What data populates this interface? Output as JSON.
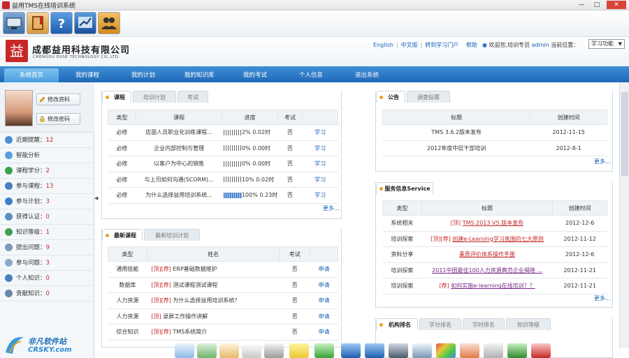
{
  "window": {
    "title": "益用TMS在线培训系统",
    "min": "—",
    "max": "□",
    "close": "✕"
  },
  "header": {
    "logo_char": "益",
    "company": "成都益用科技有限公司",
    "company_en": "CHENGDU EUSE TECHNOLOGY CO.,LTD.",
    "links": [
      "English",
      "中文版",
      "转到学习门户",
      "帮助"
    ],
    "welcome": "欢迎您,培训专员",
    "user": "admin",
    "position_label": "当前位置：",
    "func_select": "学习功能"
  },
  "nav": [
    "系统首页",
    "我的课程",
    "我的计划",
    "我的知识库",
    "我的考试",
    "个人信息",
    "退出系统"
  ],
  "sidebar": {
    "edit_profile": "修改资料",
    "edit_password": "修改密码",
    "items": [
      {
        "label": "近期提醒：",
        "count": "12",
        "color": "#4a8fd0"
      },
      {
        "label": "智能分析",
        "count": "",
        "color": "#5aa0e0"
      },
      {
        "label": "课程学分：",
        "count": "2",
        "color": "#3aa34a"
      },
      {
        "label": "参与课程：",
        "count": "13",
        "color": "#4a7fc0"
      },
      {
        "label": "参与计划：",
        "count": "3",
        "color": "#3a83c8"
      },
      {
        "label": "获得认证：",
        "count": "0",
        "color": "#5a90c0"
      },
      {
        "label": "知识等级：",
        "count": "1",
        "color": "#3aa34a"
      },
      {
        "label": "提出问题：",
        "count": "9",
        "color": "#7a9ab8"
      },
      {
        "label": "参与问题：",
        "count": "3",
        "color": "#8aa8c8"
      },
      {
        "label": "个人知识：",
        "count": "0",
        "color": "#4a7fc0"
      },
      {
        "label": "贡献知识：",
        "count": "0",
        "color": "#6a88a8"
      }
    ]
  },
  "course_panel": {
    "tabs": [
      "课程",
      "培训计划",
      "考试"
    ],
    "headers": [
      "类型",
      "课程",
      "进度",
      "考试",
      ""
    ],
    "rows": [
      {
        "type": "必修",
        "course": "店面人员职业化训练课程...",
        "progress": "2% 0.02时",
        "exam": "否",
        "action": "学习",
        "full": false
      },
      {
        "type": "必修",
        "course": "企业内部控制与管理",
        "progress": "0% 0.00时",
        "exam": "否",
        "action": "学习",
        "full": false
      },
      {
        "type": "必修",
        "course": "以客户为中心的销售",
        "progress": "0% 0.00时",
        "exam": "否",
        "action": "学习",
        "full": false
      },
      {
        "type": "必修",
        "course": "与上司如何沟通(SCORM)...",
        "progress": "10% 0.02时",
        "exam": "否",
        "action": "学习",
        "full": false
      },
      {
        "type": "必修",
        "course": "为什么选择益用培训系统...",
        "progress": "100% 0.23时",
        "exam": "否",
        "action": "学习",
        "full": true
      }
    ],
    "more": "更多..."
  },
  "newcourse_panel": {
    "tabs": [
      "最新课程",
      "最新培训计划"
    ],
    "headers": [
      "类型",
      "姓名",
      "考试",
      ""
    ],
    "rows": [
      {
        "type": "通用技能",
        "tag": "[顶][荐]",
        "name": "ERP基础数据维护",
        "exam": "否",
        "action": "申请"
      },
      {
        "type": "数据库",
        "tag": "[顶][荐]",
        "name": "测试课程测试课程",
        "exam": "否",
        "action": "申请"
      },
      {
        "type": "人力资源",
        "tag": "[顶][荐]",
        "name": "为什么选择益用培训系统？",
        "exam": "否",
        "action": "申请"
      },
      {
        "type": "人力资源",
        "tag": "[顶]",
        "name": "录屏工作操作讲解",
        "exam": "否",
        "action": "申请"
      },
      {
        "type": "综合知识",
        "tag": "[顶][荐]",
        "name": "TMS系统简介",
        "exam": "否",
        "action": "申请"
      }
    ]
  },
  "notice_panel": {
    "tabs": [
      "公告",
      "调查投票"
    ],
    "headers": [
      "标题",
      "创建时间"
    ],
    "rows": [
      {
        "title": "TMS 3.6.2版本发布",
        "date": "2012-11-15"
      },
      {
        "title": "2012年度中层干部培训",
        "date": "2012-8-1"
      }
    ],
    "more": "更多..."
  },
  "service_panel": {
    "tabs": [
      "服务信息Service"
    ],
    "headers": [
      "类型",
      "标题",
      "创建时间"
    ],
    "rows": [
      {
        "type": "系统相关",
        "tag": "[顶]",
        "title": "TMS 2013 V5 版本发布",
        "date": "2012-12-6"
      },
      {
        "type": "培训探索",
        "tag": "[顶][荐]",
        "title": "创建e-Learning学习氛围的七大原则",
        "date": "2012-11-12"
      },
      {
        "type": "资料分享",
        "tag": "",
        "title": "素质评价体系操作手册",
        "date": "2012-12-6"
      },
      {
        "type": "培训探索",
        "tag": "",
        "title": "2011中国最佳100人力资源典范企业揭晓 ...",
        "date": "2012-11-21"
      },
      {
        "type": "培训探索",
        "tag": "[荐]",
        "title": "如何实施e-learning在线培训？？",
        "date": "2012-11-21"
      }
    ],
    "more": "更多..."
  },
  "org_panel": {
    "tabs": [
      "机构排名",
      "学分排名",
      "学时排名",
      "知识等级"
    ]
  },
  "watermark": {
    "brand": "非凡软件站",
    "domain": "CRSKY.com"
  }
}
